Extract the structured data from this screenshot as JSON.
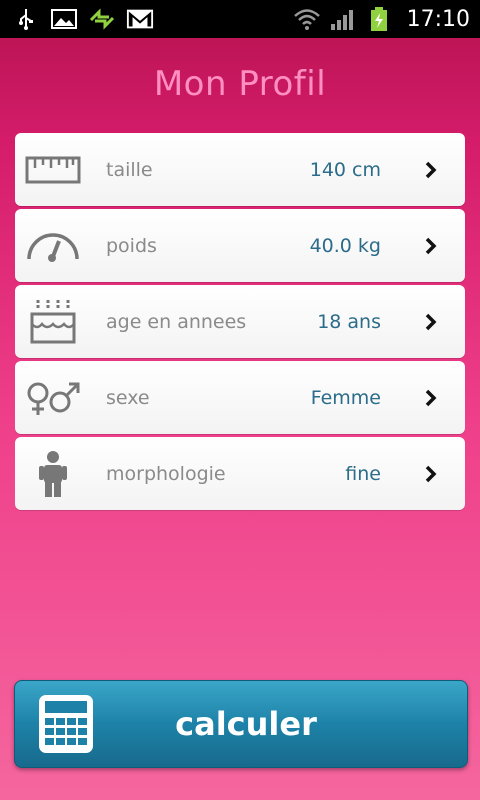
{
  "status_bar": {
    "time": "17:10",
    "icons": [
      "usb-icon",
      "gallery-icon",
      "sync-icon",
      "gmail-icon",
      "wifi-icon",
      "signal-icon",
      "battery-charging-icon"
    ]
  },
  "header": {
    "title": "Mon Profil"
  },
  "profile_rows": [
    {
      "icon": "ruler-icon",
      "label": "taille",
      "value": "140 cm"
    },
    {
      "icon": "gauge-icon",
      "label": "poids",
      "value": "40.0 kg"
    },
    {
      "icon": "birthday-cake-icon",
      "label": "age en annees",
      "value": "18 ans"
    },
    {
      "icon": "gender-icon",
      "label": "sexe",
      "value": "Femme"
    },
    {
      "icon": "body-figure-icon",
      "label": "morphologie",
      "value": "fine"
    }
  ],
  "action": {
    "label": "calculer",
    "icon": "calculator-icon"
  },
  "colors": {
    "title": "#ff8fc0",
    "value_text": "#2b6c8a",
    "label_text": "#8a8a8a",
    "button": "#1e82a8"
  }
}
